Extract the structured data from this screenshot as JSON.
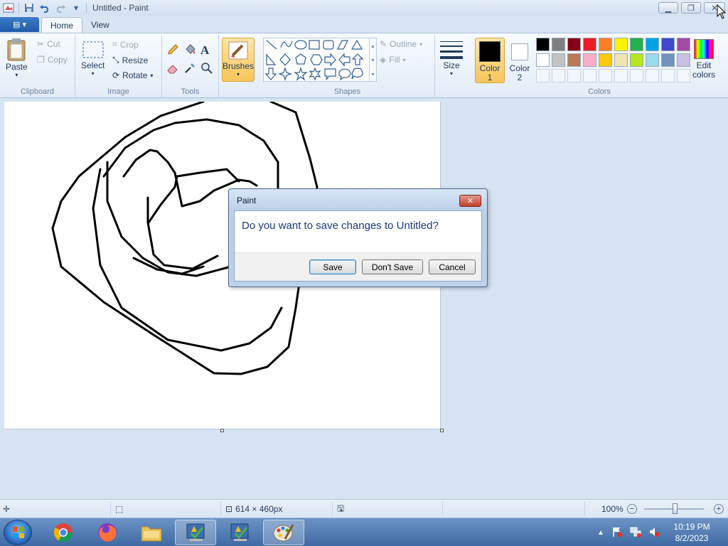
{
  "window": {
    "title": "Untitled - Paint",
    "controls": {
      "minimize": "minimize-icon",
      "restore": "restore-icon",
      "close": "close-icon"
    }
  },
  "quick_access": [
    "save-icon",
    "undo-icon",
    "redo-icon",
    "customize-qat-icon"
  ],
  "tabs": [
    {
      "label": "Home",
      "active": true
    },
    {
      "label": "View",
      "active": false
    }
  ],
  "ribbon": {
    "clipboard": {
      "group_label": "Clipboard",
      "paste": "Paste",
      "cut": "Cut",
      "copy": "Copy"
    },
    "image": {
      "group_label": "Image",
      "select": "Select",
      "crop": "Crop",
      "resize": "Resize",
      "rotate": "Rotate"
    },
    "tools": {
      "group_label": "Tools"
    },
    "brushes": {
      "label": "Brushes"
    },
    "shapes": {
      "group_label": "Shapes",
      "outline": "Outline",
      "fill": "Fill"
    },
    "size": {
      "label": "Size"
    },
    "colors": {
      "group_label": "Colors",
      "color1_label": "Color",
      "color1_num": "1",
      "color2_label": "Color",
      "color2_num": "2",
      "edit_label": "Edit",
      "edit_label2": "colors",
      "color1": "#000000",
      "color2": "#ffffff",
      "palette_row1": [
        "#000000",
        "#7f7f7f",
        "#880015",
        "#ed1c24",
        "#ff7f27",
        "#fff200",
        "#22b14c",
        "#00a2e8",
        "#3f48cc",
        "#a349a4"
      ],
      "palette_row2": [
        "#ffffff",
        "#c3c3c3",
        "#b97a57",
        "#ffaec9",
        "#ffc90e",
        "#efe4b0",
        "#b5e61d",
        "#99d9ea",
        "#7092be",
        "#c8bfe7"
      ]
    }
  },
  "dialog": {
    "title": "Paint",
    "message": "Do you want to save changes to Untitled?",
    "buttons": {
      "save": "Save",
      "dont_save": "Don't Save",
      "cancel": "Cancel"
    }
  },
  "statusbar": {
    "dimensions": "614 × 460px",
    "zoom": "100%"
  },
  "taskbar": {
    "apps": [
      "chrome-icon",
      "firefox-icon",
      "file-explorer-icon",
      "task-app-icon",
      "task-app-icon",
      "paint-icon"
    ],
    "time": "10:19 PM",
    "date": "8/2/2023"
  }
}
